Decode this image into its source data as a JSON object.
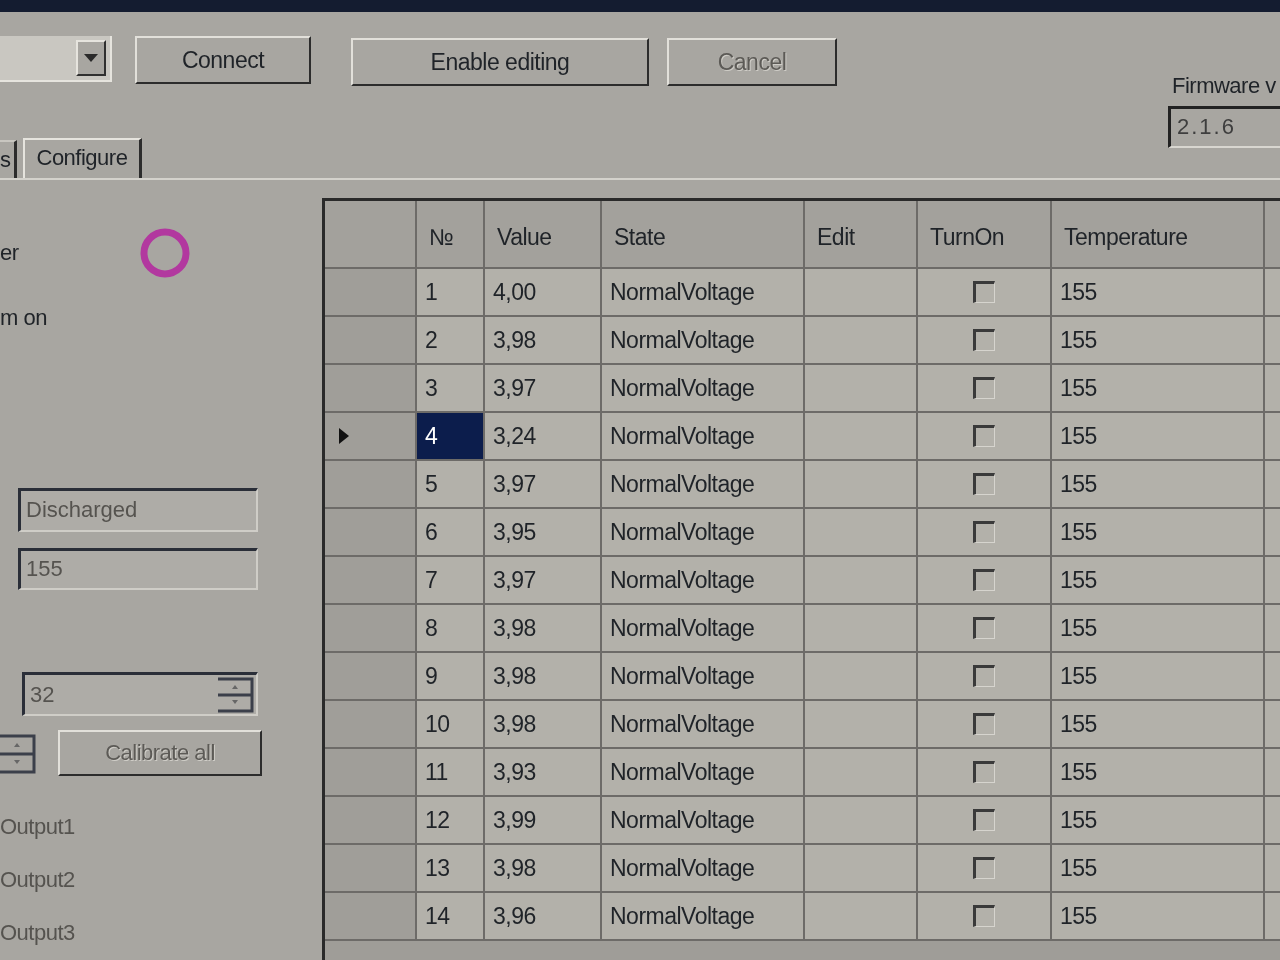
{
  "toolbar": {
    "buttons": [
      {
        "label": "Connect",
        "disabled": false
      },
      {
        "label": "Enable editing",
        "disabled": false
      },
      {
        "label": "Cancel",
        "disabled": true
      }
    ]
  },
  "firmware": {
    "label": "Firmware v",
    "value": "2.1.6"
  },
  "tabs": [
    {
      "label": "s",
      "selected": false
    },
    {
      "label": "Configure",
      "selected": true
    }
  ],
  "left_panel": {
    "ring_label": "er",
    "label": "m on",
    "fields": [
      {
        "kind": "text",
        "value": "Discharged",
        "disabled": true
      },
      {
        "kind": "text",
        "value": "155",
        "disabled": true
      },
      {
        "kind": "spin",
        "value": "32",
        "disabled": true
      }
    ],
    "calibrate_button": {
      "label": "Calibrate all",
      "disabled": true
    },
    "outputs": [
      {
        "label": "Output1",
        "disabled": true
      },
      {
        "label": "Output2",
        "disabled": true
      },
      {
        "label": "Output3",
        "disabled": true
      }
    ]
  },
  "table": {
    "columns": [
      "№",
      "Value",
      "State",
      "Edit",
      "TurnOn",
      "Temperature"
    ],
    "rows": [
      {
        "number": "1",
        "value": "4,00",
        "state": "NormalVoltage",
        "checked": false,
        "temperature": "155",
        "selected": false
      },
      {
        "number": "2",
        "value": "3,98",
        "state": "NormalVoltage",
        "checked": false,
        "temperature": "155",
        "selected": false
      },
      {
        "number": "3",
        "value": "3,97",
        "state": "NormalVoltage",
        "checked": false,
        "temperature": "155",
        "selected": false
      },
      {
        "number": "4",
        "value": "3,24",
        "state": "NormalVoltage",
        "checked": false,
        "temperature": "155",
        "selected": true
      },
      {
        "number": "5",
        "value": "3,97",
        "state": "NormalVoltage",
        "checked": false,
        "temperature": "155",
        "selected": false
      },
      {
        "number": "6",
        "value": "3,95",
        "state": "NormalVoltage",
        "checked": false,
        "temperature": "155",
        "selected": false
      },
      {
        "number": "7",
        "value": "3,97",
        "state": "NormalVoltage",
        "checked": false,
        "temperature": "155",
        "selected": false
      },
      {
        "number": "8",
        "value": "3,98",
        "state": "NormalVoltage",
        "checked": false,
        "temperature": "155",
        "selected": false
      },
      {
        "number": "9",
        "value": "3,98",
        "state": "NormalVoltage",
        "checked": false,
        "temperature": "155",
        "selected": false
      },
      {
        "number": "10",
        "value": "3,98",
        "state": "NormalVoltage",
        "checked": false,
        "temperature": "155",
        "selected": false
      },
      {
        "number": "11",
        "value": "3,93",
        "state": "NormalVoltage",
        "checked": false,
        "temperature": "155",
        "selected": false
      },
      {
        "number": "12",
        "value": "3,99",
        "state": "NormalVoltage",
        "checked": false,
        "temperature": "155",
        "selected": false
      },
      {
        "number": "13",
        "value": "3,98",
        "state": "NormalVoltage",
        "checked": false,
        "temperature": "155",
        "selected": false
      },
      {
        "number": "14",
        "value": "3,96",
        "state": "NormalVoltage",
        "checked": false,
        "temperature": "155",
        "selected": false
      }
    ]
  }
}
